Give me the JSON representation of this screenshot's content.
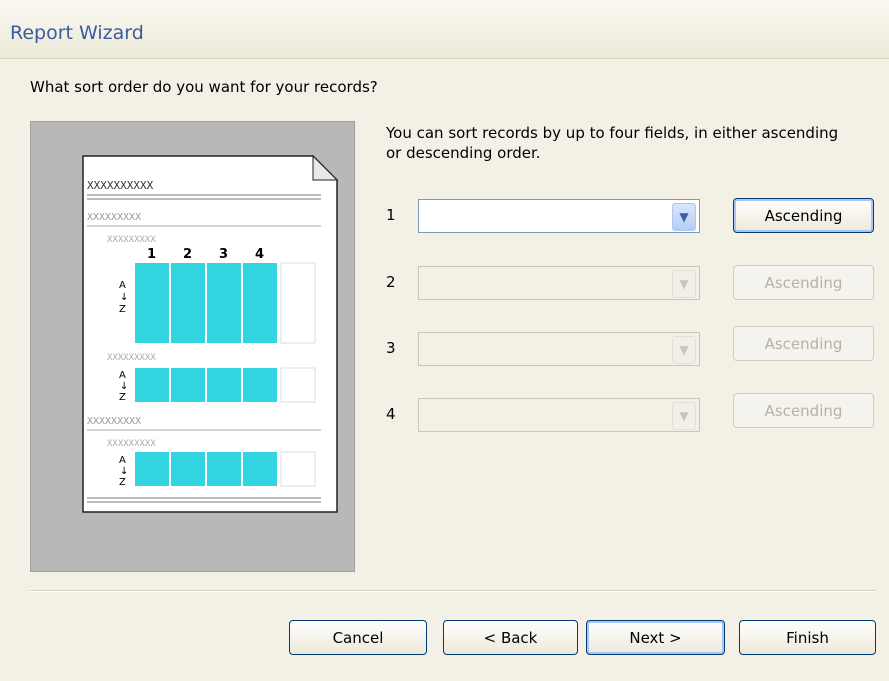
{
  "window": {
    "title": "Report Wizard"
  },
  "question": "What sort order do you want for your records?",
  "info_text": "You can sort records by up to four fields, in either ascending or descending order.",
  "preview": {
    "header_text": "XXXXXXXXXX",
    "group_text": "XXXXXXXXX",
    "columns": [
      "1",
      "2",
      "3",
      "4"
    ],
    "sort_top": "A",
    "sort_bottom": "Z"
  },
  "sort_fields": [
    {
      "number": "1",
      "value": "",
      "order": "Ascending",
      "enabled": true
    },
    {
      "number": "2",
      "value": "",
      "order": "Ascending",
      "enabled": false
    },
    {
      "number": "3",
      "value": "",
      "order": "Ascending",
      "enabled": false
    },
    {
      "number": "4",
      "value": "",
      "order": "Ascending",
      "enabled": false
    }
  ],
  "buttons": {
    "cancel": "Cancel",
    "back": "< Back",
    "next": "Next >",
    "finish": "Finish"
  },
  "colors": {
    "accent": "#3a5ba0",
    "highlight": "#33d5e0"
  },
  "icons": {
    "dropdown": "chevron-down-icon"
  }
}
